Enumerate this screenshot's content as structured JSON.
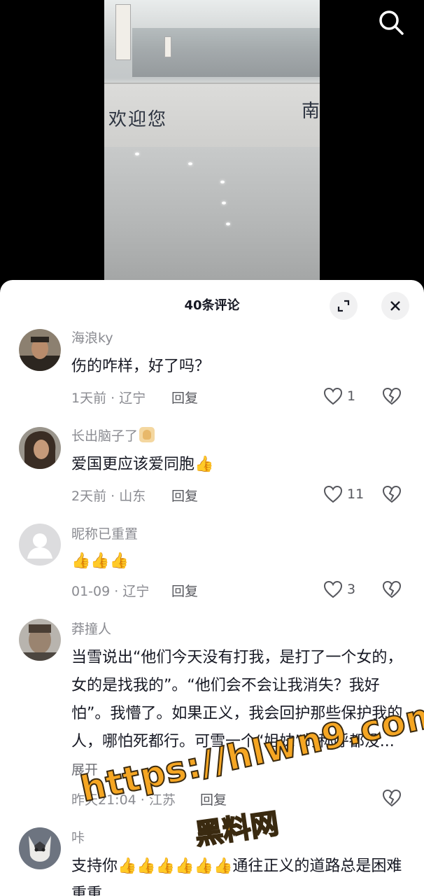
{
  "video": {
    "sign_text": "欢迎您",
    "sign_text_right": "南"
  },
  "sheet": {
    "title": "40条评论",
    "reply_label": "回复",
    "expand_label": "展开"
  },
  "comments": [
    {
      "username": "海浪ky",
      "text": "伤的咋样，好了吗？",
      "meta": "1天前 · 辽宁",
      "likes": "1",
      "avatar_color": "#6b5a48"
    },
    {
      "username": "长出脑子了",
      "text": "爱国更应该爱同胞",
      "thumbs": 1,
      "meta": "2天前 · 山东",
      "likes": "11",
      "avatar_color": "#5a4d42"
    },
    {
      "username": "昵称已重置",
      "text": "",
      "thumbs": 3,
      "meta": "01-09 · 辽宁",
      "likes": "3",
      "avatar_color": "#d9d9db"
    },
    {
      "username": "莽撞人",
      "text": "当雪说出“他们今天没有打我，是打了一个女的，女的是找我的”。“他们会不会让我消失？我好怕”。我懵了。如果正义，我会回护那些保护我的人，哪怕死都行。可雪一个“姐妹”的称呼都没...",
      "meta": "昨天21:04 · 江苏",
      "likes": "",
      "avatar_color": "#7a6d60"
    },
    {
      "username": "咔",
      "text": "支持你",
      "text_after": "通往正义的道路总是困难重重",
      "thumbs": 6,
      "avatar_color": "#3c3f45"
    }
  ],
  "watermark": {
    "url": "https://hlwn9.com",
    "name": "黑料网"
  },
  "colors": {
    "sheet_bg": "#ffffff",
    "text_primary": "#161823",
    "text_secondary": "#8a8b91",
    "watermark": "#f5a623"
  }
}
